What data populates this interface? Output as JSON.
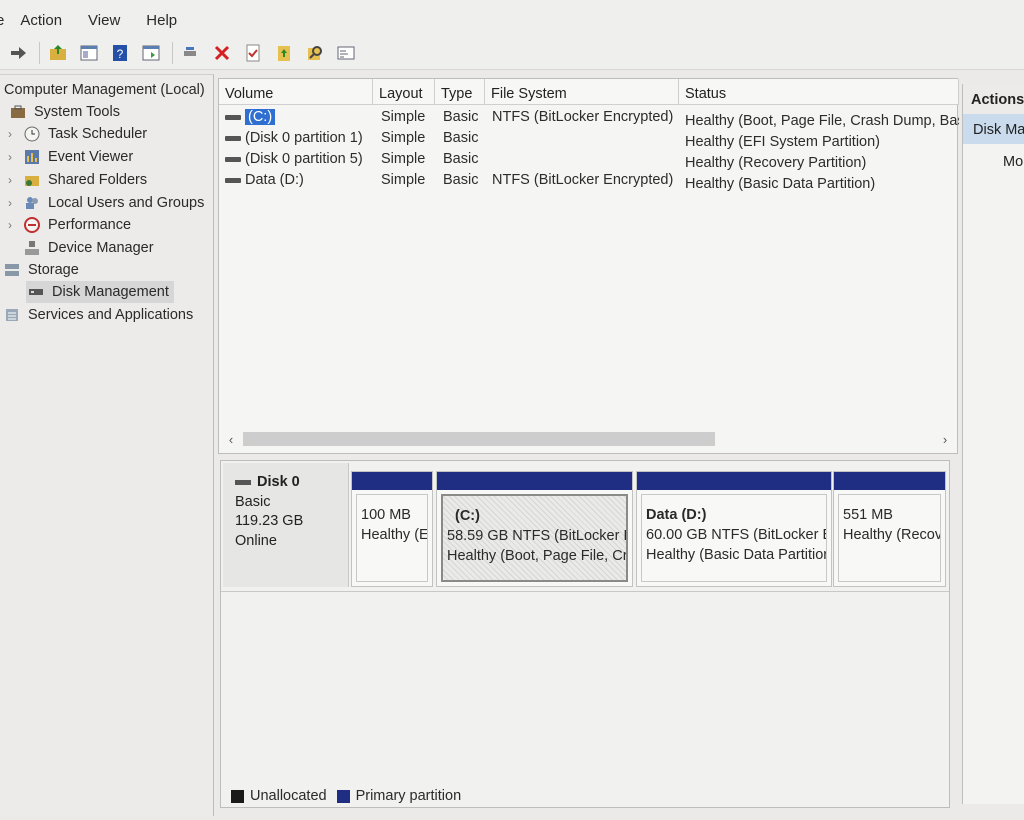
{
  "menu": [
    "e",
    "Action",
    "View",
    "Help"
  ],
  "toolbar": [
    "back-arrow-icon",
    "up-folder-icon",
    "console-icon",
    "help-icon",
    "properties-icon",
    "connect-icon",
    "delete-icon",
    "check-icon",
    "export-icon",
    "search-icon",
    "settings-icon"
  ],
  "tree": {
    "root": "Computer Management (Local)",
    "system_tools": "System Tools",
    "task_scheduler": "Task Scheduler",
    "event_viewer": "Event Viewer",
    "shared_folders": "Shared Folders",
    "local_users": "Local Users and Groups",
    "performance": "Performance",
    "device_manager": "Device Manager",
    "storage": "Storage",
    "disk_management": "Disk Management",
    "services": "Services and Applications"
  },
  "columns": {
    "volume": "Volume",
    "layout": "Layout",
    "type": "Type",
    "fs": "File System",
    "status": "Status"
  },
  "volumes": [
    {
      "volume": "(C:)",
      "layout": "Simple",
      "type": "Basic",
      "fs": "NTFS (BitLocker Encrypted)",
      "status": "Healthy (Boot, Page File, Crash Dump, Bas"
    },
    {
      "volume": "(Disk 0 partition 1)",
      "layout": "Simple",
      "type": "Basic",
      "fs": "",
      "status": "Healthy (EFI System Partition)"
    },
    {
      "volume": "(Disk 0 partition 5)",
      "layout": "Simple",
      "type": "Basic",
      "fs": "",
      "status": "Healthy (Recovery Partition)"
    },
    {
      "volume": "Data (D:)",
      "layout": "Simple",
      "type": "Basic",
      "fs": "NTFS (BitLocker Encrypted)",
      "status": "Healthy (Basic Data Partition)"
    }
  ],
  "disk": {
    "name": "Disk 0",
    "type": "Basic",
    "size": "119.23 GB",
    "state": "Online",
    "partitions": [
      {
        "title": "",
        "size": "100 MB",
        "status": "Healthy (E"
      },
      {
        "title": "(C:)",
        "size": "58.59 GB NTFS (BitLocker Er",
        "status": "Healthy (Boot, Page File, Cra"
      },
      {
        "title": "Data  (D:)",
        "size": "60.00 GB NTFS (BitLocker Er",
        "status": "Healthy (Basic Data Partitior"
      },
      {
        "title": "",
        "size": "551 MB",
        "status": "Healthy (Recov"
      }
    ]
  },
  "legend": {
    "unallocated": "Unallocated",
    "primary": "Primary partition",
    "unallocated_color": "#1a1a1a",
    "primary_color": "#1f2e83"
  },
  "actions": {
    "header": "Actions",
    "item": "Disk Ma",
    "more": "Mo"
  },
  "colors": {
    "partition_bar": "#1f2e83",
    "selection": "#2f6fd1"
  }
}
